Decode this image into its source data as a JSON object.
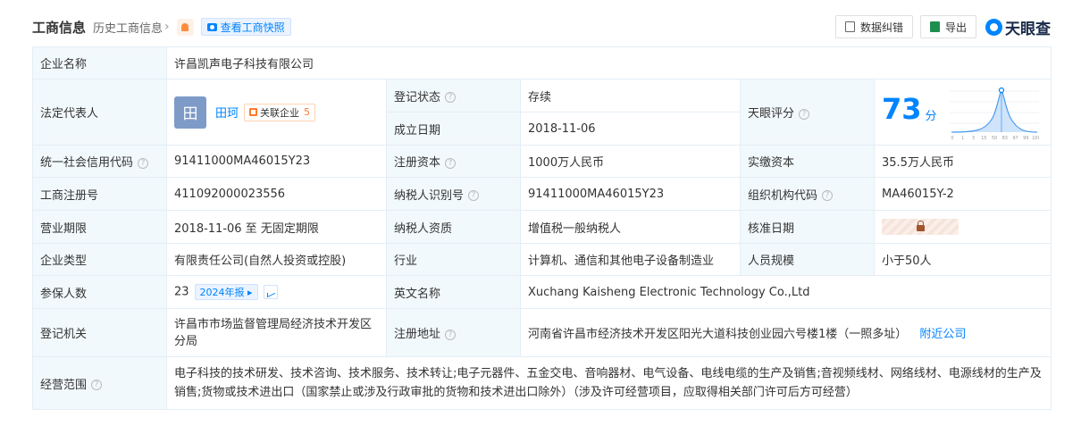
{
  "header": {
    "title": "工商信息",
    "history_link": "历史工商信息",
    "snapshot_button": "查看工商快照",
    "correct_button": "数据纠错",
    "export_button": "导出",
    "logo_text": "天眼查"
  },
  "rows": {
    "company_name": {
      "label": "企业名称",
      "value": "许昌凯声电子科技有限公司"
    },
    "legal_rep": {
      "label": "法定代表人",
      "avatar_char": "田",
      "name": "田珂",
      "related_label": "关联企业",
      "related_count": "5"
    },
    "reg_status": {
      "label": "登记状态",
      "value": "存续"
    },
    "founded": {
      "label": "成立日期",
      "value": "2018-11-06"
    },
    "tianyan_score": {
      "label": "天眼评分",
      "value": "73",
      "unit": "分",
      "axis": [
        "0",
        "1",
        "3",
        "15",
        "50",
        "83",
        "97",
        "99",
        "100"
      ]
    },
    "credit_code": {
      "label": "统一社会信用代码",
      "value": "91411000MA46015Y23"
    },
    "reg_capital": {
      "label": "注册资本",
      "value": "1000万人民币"
    },
    "paid_capital": {
      "label": "实缴资本",
      "value": "35.5万人民币"
    },
    "reg_number": {
      "label": "工商注册号",
      "value": "411092000023556"
    },
    "taxpayer_id": {
      "label": "纳税人识别号",
      "value": "91411000MA46015Y23"
    },
    "org_code": {
      "label": "组织机构代码",
      "value": "MA46015Y-2"
    },
    "term": {
      "label": "营业期限",
      "value": "2018-11-06 至 无固定期限"
    },
    "taxpayer_qual": {
      "label": "纳税人资质",
      "value": "增值税一般纳税人"
    },
    "approval_date": {
      "label": "核准日期"
    },
    "company_type": {
      "label": "企业类型",
      "value": "有限责任公司(自然人投资或控股)"
    },
    "industry": {
      "label": "行业",
      "value": "计算机、通信和其他电子设备制造业"
    },
    "staff_size": {
      "label": "人员规模",
      "value": "小于50人"
    },
    "insured": {
      "label": "参保人数",
      "value": "23",
      "report_tag": "2024年报"
    },
    "english_name": {
      "label": "英文名称",
      "value": "Xuchang Kaisheng Electronic Technology Co.,Ltd"
    },
    "reg_authority": {
      "label": "登记机关",
      "value": "许昌市市场监督管理局经济技术开发区分局"
    },
    "reg_address": {
      "label": "注册地址",
      "value": "河南省许昌市经济技术开发区阳光大道科技创业园六号楼1楼（一照多址）",
      "nearby_link": "附近公司"
    },
    "scope": {
      "label": "经营范围",
      "value": "电子科技的技术研发、技术咨询、技术服务、技术转让;电子元器件、五金交电、音响器材、电气设备、电线电缆的生产及销售;音视频线材、网络线材、电源线材的生产及销售;货物或技术进出口（国家禁止或涉及行政审批的货物和技术进出口除外）（涉及许可经营项目，应取得相关部门许可后方可经营）"
    }
  },
  "colors": {
    "accent": "#0084ff",
    "label_bg": "#f2f9fc",
    "status_green": "#00a85a",
    "border": "#e4eef6"
  }
}
